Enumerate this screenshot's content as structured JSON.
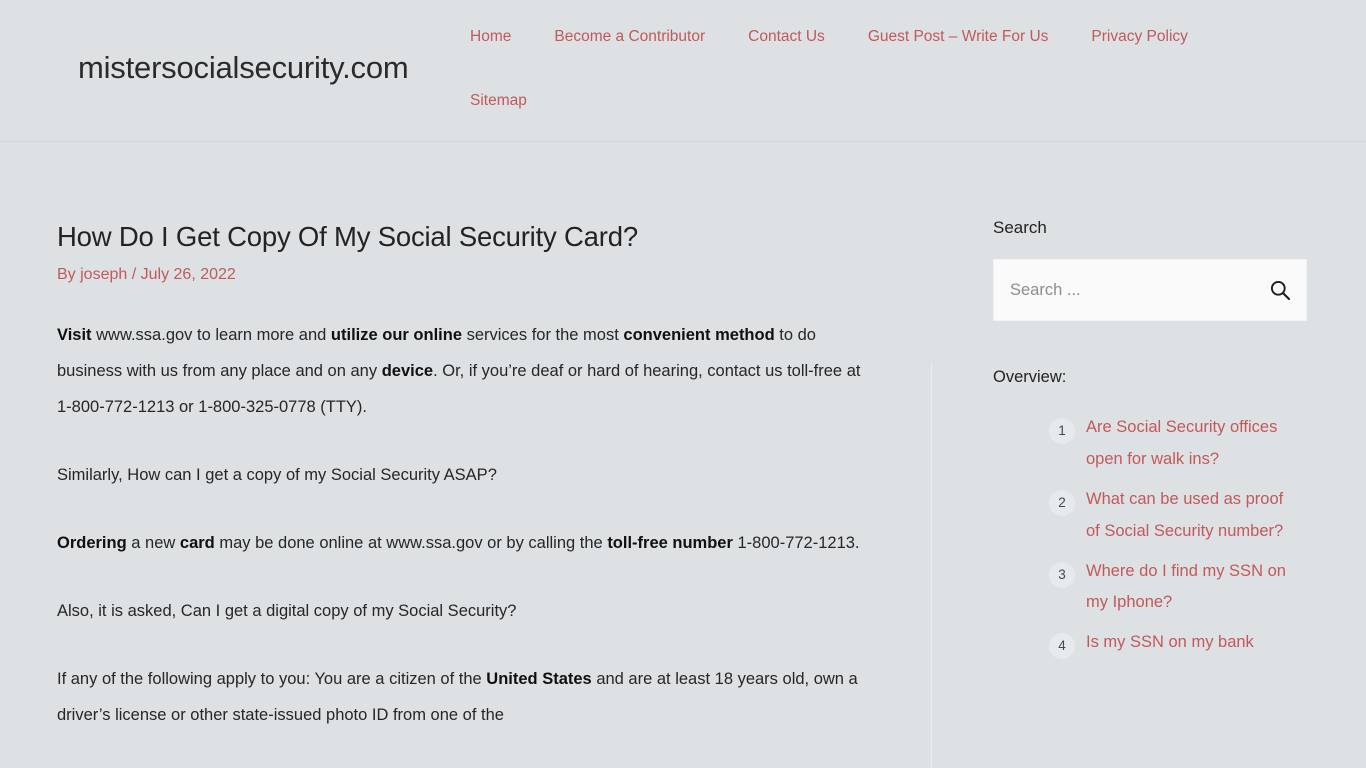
{
  "site": {
    "title": "mistersocialsecurity.com",
    "accent_color": "#c2595a",
    "background_color": "#dde1e3",
    "text_color": "#262626"
  },
  "nav": {
    "primary": [
      {
        "label": "Home"
      },
      {
        "label": "Become a Contributor"
      },
      {
        "label": "Contact Us"
      },
      {
        "label": "Guest Post – Write For Us"
      },
      {
        "label": "Privacy Policy"
      }
    ],
    "secondary": [
      {
        "label": "Sitemap"
      }
    ]
  },
  "article": {
    "title": "How Do I Get Copy Of My Social Security Card?",
    "byline_prefix": "By ",
    "author": "joseph",
    "byline_separator": " / ",
    "date": "July 26, 2022",
    "paragraphs": [
      {
        "runs": [
          {
            "text": "Visit",
            "bold": true
          },
          {
            "text": " www.ssa.gov to learn more and ",
            "bold": false
          },
          {
            "text": "utilize our online",
            "bold": true
          },
          {
            "text": " services for the most ",
            "bold": false
          },
          {
            "text": "convenient method",
            "bold": true
          },
          {
            "text": " to do business with us from any place and on any ",
            "bold": false
          },
          {
            "text": "device",
            "bold": true
          },
          {
            "text": ". Or, if you’re deaf or hard of hearing, contact us toll-free at 1-800-772-1213 or 1-800-325-0778 (TTY).",
            "bold": false
          }
        ]
      },
      {
        "runs": [
          {
            "text": "Similarly, How can I get a copy of my Social Security ASAP?",
            "bold": false
          }
        ]
      },
      {
        "runs": [
          {
            "text": "Ordering",
            "bold": true
          },
          {
            "text": " a new ",
            "bold": false
          },
          {
            "text": "card",
            "bold": true
          },
          {
            "text": " may be done online at www.ssa.gov or by calling the ",
            "bold": false
          },
          {
            "text": "toll-free number",
            "bold": true
          },
          {
            "text": " 1-800-772-1213.",
            "bold": false
          }
        ]
      },
      {
        "runs": [
          {
            "text": "Also, it is asked, Can I get a digital copy of my Social Security?",
            "bold": false
          }
        ]
      },
      {
        "runs": [
          {
            "text": "If any of the following apply to you: You are a citizen of the ",
            "bold": false
          },
          {
            "text": "United States",
            "bold": true
          },
          {
            "text": " and are at least 18 years old, own a driver’s license or other state-issued photo ID from one of the",
            "bold": false
          }
        ]
      }
    ]
  },
  "sidebar": {
    "search": {
      "widget_title": "Search",
      "placeholder": "Search ...",
      "value": "",
      "submit_icon": "search-icon"
    },
    "overview": {
      "label": "Overview:",
      "items": [
        {
          "number": "1",
          "label": "Are Social Security offices open for walk ins?"
        },
        {
          "number": "2",
          "label": "What can be used as proof of Social Security number?"
        },
        {
          "number": "3",
          "label": "Where do I find my SSN on my Iphone?"
        },
        {
          "number": "4",
          "label": "Is my SSN on my bank"
        }
      ]
    }
  }
}
